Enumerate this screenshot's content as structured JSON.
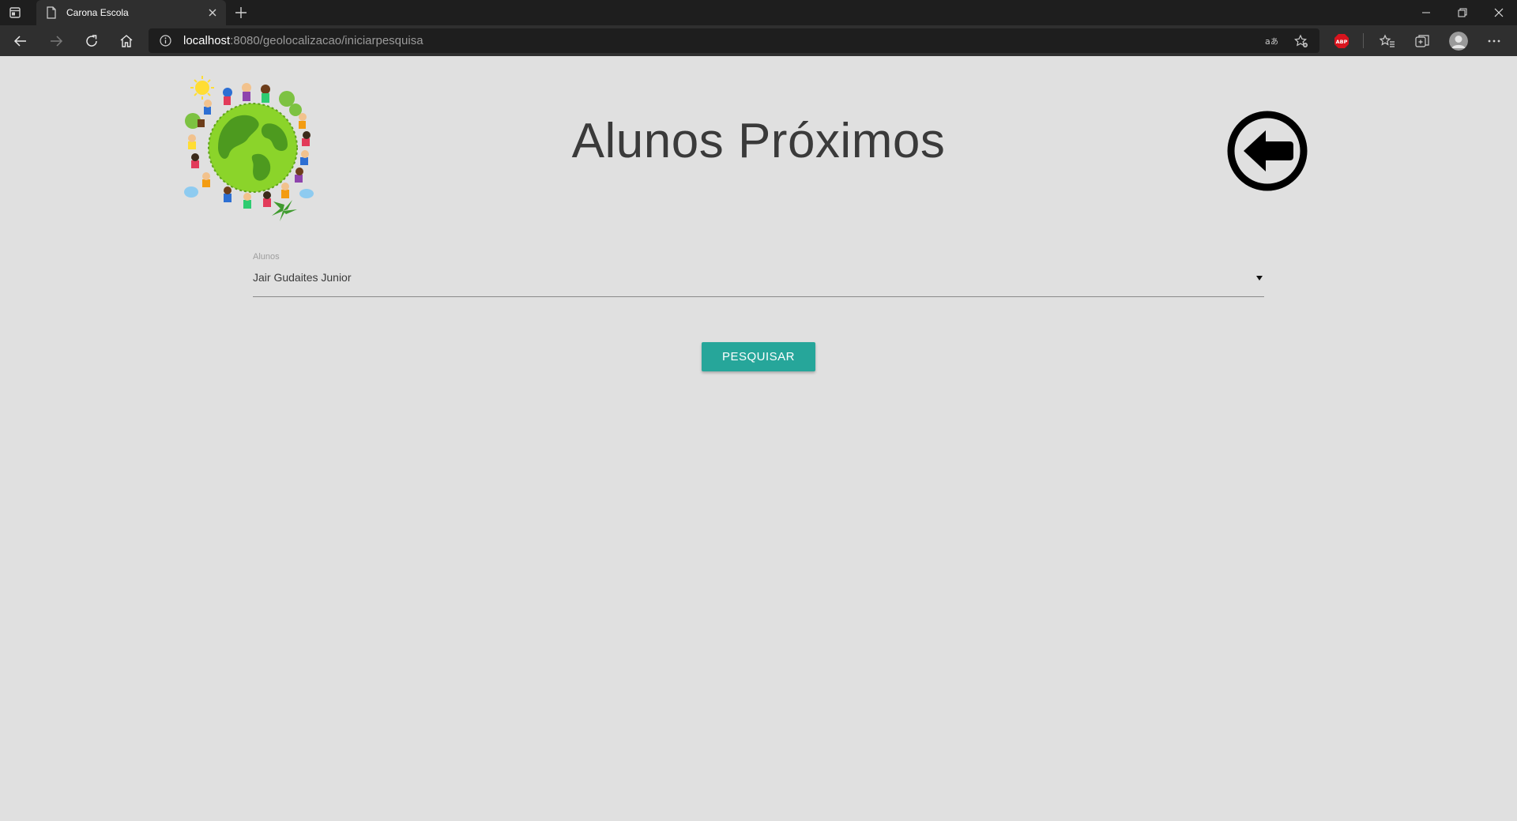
{
  "browser": {
    "tab_title": "Carona Escola",
    "url_host": "localhost",
    "url_rest": ":8080/geolocalizacao/iniciarpesquisa",
    "extension_abp": "ABP"
  },
  "page": {
    "title": "Alunos Próximos",
    "field_label": "Alunos",
    "selected_student": "Jair Gudaites Junior",
    "search_button": "PESQUISAR"
  },
  "colors": {
    "page_bg": "#e0e0e0",
    "button": "#26a69a",
    "title_text": "#3a3a3a"
  },
  "icons": {
    "logo": "globe-children-logo",
    "back": "back-arrow-circle-icon"
  }
}
